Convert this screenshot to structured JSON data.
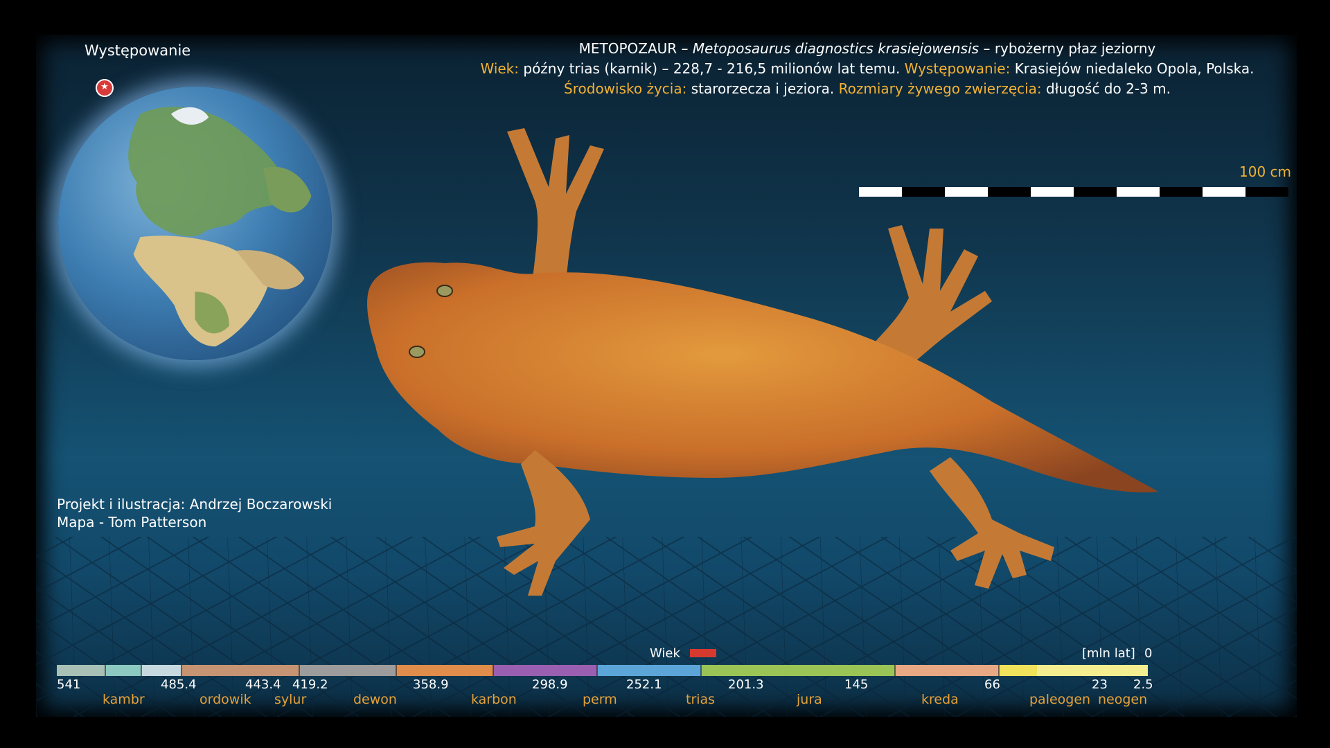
{
  "header": {
    "line1_name": "METOPOZAUR",
    "line1_dash1": "–",
    "line1_species": "Metoposaurus diagnostics krasiejowensis",
    "line1_dash2": "–",
    "line1_desc": "rybożerny płaz jeziorny",
    "age_label": "Wiek:",
    "age_value": "późny trias (karnik) – 228,7 - 216,5 milionów lat temu.",
    "occurrence_label": "Występowanie:",
    "occurrence_value": "Krasiejów niedaleko Opola, Polska.",
    "habitat_label": "Środowisko życia:",
    "habitat_value": "starorzecza i jeziora.",
    "size_label": "Rozmiary żywego zwierzęcia:",
    "size_value": "długość do 2-3 m."
  },
  "legend": {
    "star_glyph": "★",
    "label": "Występowanie"
  },
  "scale": {
    "label": "100 cm"
  },
  "credits": {
    "line1": "Projekt i ilustracja: Andrzej Boczarowski",
    "line2": "Mapa - Tom Patterson"
  },
  "timeline": {
    "wiek_label": "Wiek",
    "unit_label": "[mln lat]",
    "zero_label": "0",
    "ticks": [
      "541",
      "485.4",
      "443.4",
      "419.2",
      "358.9",
      "298.9",
      "252.1",
      "201.3",
      "145",
      "66",
      "23",
      "2.5"
    ],
    "periods": [
      "kambr",
      "ordowik",
      "sylur",
      "dewon",
      "karbon",
      "perm",
      "trias",
      "jura",
      "kreda",
      "paleogen",
      "neogen"
    ],
    "colors": {
      "highlight": "#d63a2e",
      "period_text": "#e6a238",
      "gold": "#f3b233"
    }
  }
}
